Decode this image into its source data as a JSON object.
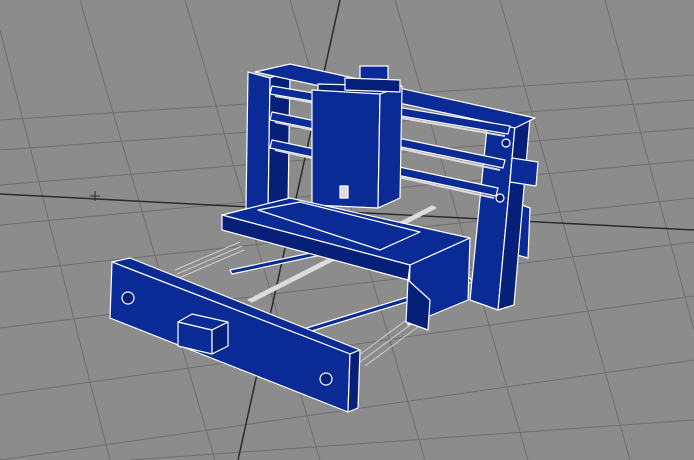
{
  "viewport": {
    "kind": "3d-perspective-viewport",
    "background": "#8c8c8c",
    "grid_color": "#6e6e6e",
    "axis_color": "#2b2b2b",
    "model_fill": "#0a2a96",
    "model_fill_dark": "#06207a",
    "edge_color": "#ffffff",
    "rail_color": "#dcdcdc"
  },
  "model": {
    "name": "cnc-router-wireframe",
    "parts": [
      "gantry-frame",
      "spindle-carriage",
      "x-axis-rails",
      "bed-table",
      "y-axis-lead-screws",
      "front-end-plate",
      "stepper-motor"
    ]
  }
}
